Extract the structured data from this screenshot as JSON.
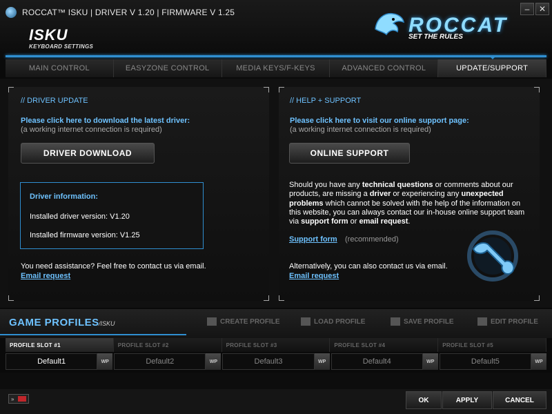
{
  "window": {
    "title": "ROCCAT™ ISKU  |  DRIVER V 1.20 |  FIRMWARE V 1.25",
    "minimize_label": "–",
    "close_label": "✕"
  },
  "brand": {
    "product": "ISKU",
    "product_sub": "KEYBOARD SETTINGS",
    "name": "ROCCAT",
    "slogan": "SET THE RULES",
    "accent_color": "#2f8fd1"
  },
  "tabs": [
    {
      "label": "MAIN CONTROL"
    },
    {
      "label": "EASYZONE CONTROL"
    },
    {
      "label": "MEDIA KEYS/F-KEYS"
    },
    {
      "label": "ADVANCED CONTROL"
    },
    {
      "label": "UPDATE/SUPPORT"
    }
  ],
  "driver_panel": {
    "title": "// DRIVER UPDATE",
    "intro": "Please click here to download the latest driver:",
    "note": "(a working internet connection is required)",
    "button_label": "DRIVER DOWNLOAD",
    "info_title": "Driver information:",
    "driver_label": "Installed driver version:",
    "driver_version": "V1.20",
    "firmware_label": "Installed firmware version:",
    "firmware_version": "V1.25",
    "assist_text": "You need assistance? Feel free to contact us via email.",
    "email_link": "Email request"
  },
  "support_panel": {
    "title": "// HELP + SUPPORT",
    "intro": "Please click here to visit our online support page:",
    "note": "(a working internet connection is required)",
    "button_label": "ONLINE SUPPORT",
    "para": {
      "p1": "Should you have any ",
      "b1": "technical questions",
      "p2": " or comments about our products, are missing a ",
      "b2": "driver",
      "p3": " or experiencing any ",
      "b3": "unexpected problems",
      "p4": " which cannot be solved with the help of the information on this website, you can always contact our in-house online support team via ",
      "b4": "support form",
      "p5": " or ",
      "b5": "email request",
      "p6": "."
    },
    "support_link": "Support form",
    "support_note": "(recommended)",
    "alt_text": "Alternatively, you can also contact us via email.",
    "email_link": "Email request"
  },
  "profiles": {
    "title": "GAME PROFILES",
    "subtitle": "/ISKU",
    "actions": [
      {
        "label": "CREATE PROFILE",
        "icon": "create-icon"
      },
      {
        "label": "LOAD PROFILE",
        "icon": "folder-icon"
      },
      {
        "label": "SAVE PROFILE",
        "icon": "save-icon"
      },
      {
        "label": "EDIT PROFILE",
        "icon": "pencil-icon"
      }
    ],
    "slots": [
      {
        "header": "PROFILE SLOT #1",
        "name": "Default1",
        "wp": "WP"
      },
      {
        "header": "PROFILE SLOT #2",
        "name": "Default2",
        "wp": "WP"
      },
      {
        "header": "PROFILE SLOT #3",
        "name": "Default3",
        "wp": "WP"
      },
      {
        "header": "PROFILE SLOT #4",
        "name": "Default4",
        "wp": "WP"
      },
      {
        "header": "PROFILE SLOT #5",
        "name": "Default5",
        "wp": "WP"
      }
    ]
  },
  "footer": {
    "expand_label": "»",
    "ok_label": "OK",
    "apply_label": "APPLY",
    "cancel_label": "CANCEL"
  }
}
